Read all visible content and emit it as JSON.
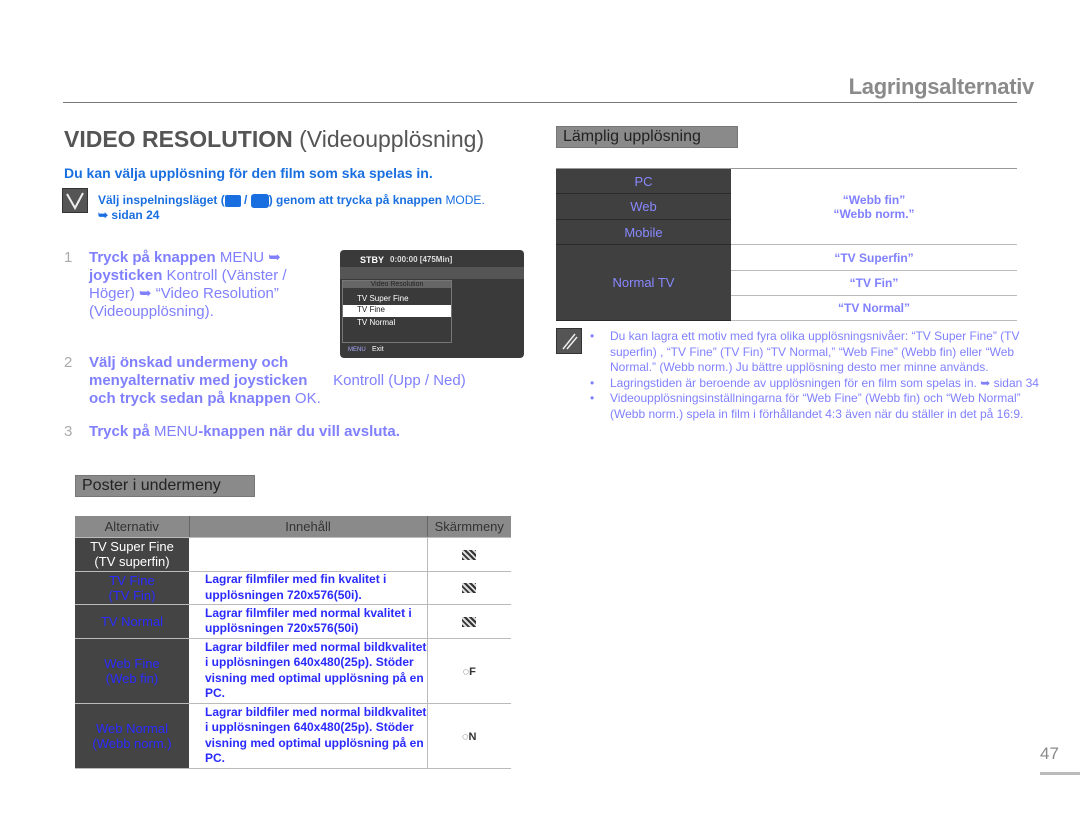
{
  "header": {
    "section": "Lagringsalternativ"
  },
  "title": {
    "main": "VIDEO RESOLUTION",
    "sub": "(Videoupplösning)"
  },
  "intro": "Du kan välja upplösning för den film som ska spelas in.",
  "precheck": {
    "text_a": "Välj inspelningsläget (",
    "text_b": " / ",
    "text_c": ") genom att trycka på knappen ",
    "mode": "MODE.",
    "ref": "➥ sidan 24"
  },
  "steps": [
    {
      "num": "1",
      "a": "Tryck på knappen ",
      "b": "MENU ➥",
      "c": "joysticken",
      "d": " Kontroll (Vänster / Höger) ➥ “Video Resolution” (Videoupplösning)."
    },
    {
      "num": "2",
      "a": "Välj önskad undermeny och menyalternativ med joysticken",
      "b": " Kontroll (Upp / Ned) ",
      "c": " och tryck sedan på knappen ",
      "d": "OK."
    },
    {
      "num": "3",
      "a": "Tryck på ",
      "b": "MENU",
      "c": "-knappen när du vill avsluta."
    }
  ],
  "screen": {
    "status": "STBY",
    "time": "0:00:00 [475Min]",
    "menu_title": "Video Resolution",
    "items": [
      "TV Super Fine",
      "TV Fine",
      "TV Normal"
    ],
    "selected": "TV Fine",
    "footer_menu": "MENU",
    "footer_exit": "Exit"
  },
  "submenu": {
    "heading": "Poster i undermeny",
    "headers": [
      "Alternativ",
      "Innehåll",
      "Skärmmeny"
    ],
    "rows": [
      {
        "option": "TV Super Fine",
        "option_sub": "(TV superfin)",
        "content": "",
        "icon": "SF"
      },
      {
        "option": "TV Fine",
        "option_sub": "(TV Fin)",
        "content": "Lagrar filmfiler med fin kvalitet i upplösningen 720x576(50i).",
        "icon": "F"
      },
      {
        "option": "TV Normal",
        "option_sub": "",
        "content": "Lagrar filmfiler med normal kvalitet i upplösningen 720x576(50i)",
        "icon": "N"
      },
      {
        "option": "Web Fine",
        "option_sub": "(Web fin)",
        "content": "Lagrar bildfiler med normal bildkvalitet i upplösningen 640x480(25p). Stöder visning med optimal upplösning på en PC.",
        "icon": "F"
      },
      {
        "option": "Web Normal",
        "option_sub": "(Webb norm.)",
        "content": "Lagrar bildfiler med normal bildkvalitet i upplösningen 640x480(25p). Stöder visning med optimal upplösning på en PC.",
        "icon": "N"
      }
    ]
  },
  "suitable": {
    "heading": "Lämplig upplösning",
    "devices": [
      "PC",
      "Web",
      "Mobile",
      "Normal TV"
    ],
    "web_settings": [
      "“Webb fin”",
      "“Webb norm.”"
    ],
    "tv_settings": [
      "“TV Superfin”",
      "“TV Fin”",
      "“TV Normal”"
    ]
  },
  "notes": [
    "Du kan lagra ett motiv med fyra olika upplösningsnivåer: “TV Super Fine” (TV superfin) , “TV Fine” (TV Fin) “TV Normal,” “Web Fine” (Webb fin) eller “Web Normal.” (Webb norm.) Ju bättre upplösning desto mer minne används.",
    "Lagringstiden är beroende av upplösningen för en film som spelas in. ➥ sidan 34",
    "Videoupplösningsinställningarna för “Web Fine” (Webb fin) och “Web Normal” (Webb norm.) spela in film i förhållandet 4:3 även när du ställer in det på 16:9."
  ],
  "page_number": "47",
  "colors": {
    "accent_blue": "#1a6fe0",
    "step_text": "#8080ff",
    "table_text": "#2a2aff",
    "dark_cell": "#444444"
  }
}
